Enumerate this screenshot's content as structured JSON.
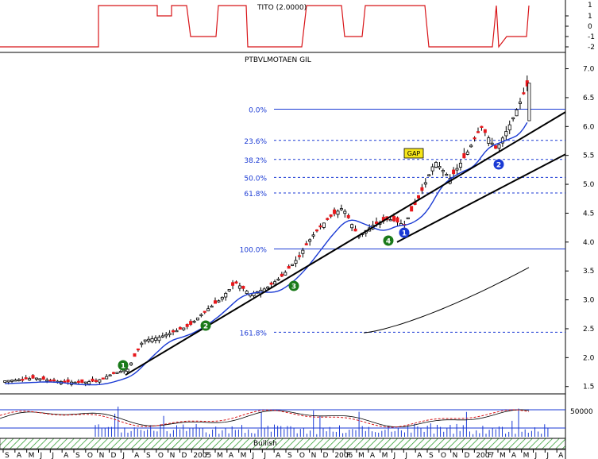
{
  "chart_data": {
    "type": "candlestick",
    "indicator_panel": {
      "label": "TITO (2.0000)",
      "y_ticks": [
        "1",
        "0",
        "-1",
        "-2"
      ],
      "y_top_tick": "1"
    },
    "price_panel": {
      "symbol": "PTBVLMOTAEN GIL",
      "y_ticks": [
        7.0,
        6.5,
        6.0,
        5.5,
        5.0,
        4.5,
        4.0,
        3.5,
        3.0,
        2.5,
        2.0,
        1.5
      ],
      "ylim": [
        1.4,
        7.2
      ],
      "fibonacci": [
        {
          "label": "0.0%",
          "value": 6.3,
          "style": "solid"
        },
        {
          "label": "23.6%",
          "value": 5.76,
          "style": "dashed"
        },
        {
          "label": "38.2%",
          "value": 5.43,
          "style": "dashed"
        },
        {
          "label": "50.0%",
          "value": 5.12,
          "style": "dashed"
        },
        {
          "label": "61.8%",
          "value": 4.85,
          "style": "dashed"
        },
        {
          "label": "100.0%",
          "value": 3.88,
          "style": "solid"
        },
        {
          "label": "161.8%",
          "value": 2.44,
          "style": "dashed"
        }
      ],
      "annotations": [
        {
          "label": "GAP"
        },
        {
          "label": "1",
          "color": "#1a7a1a"
        },
        {
          "label": "2",
          "color": "#1a7a1a"
        },
        {
          "label": "3",
          "color": "#1a7a1a"
        },
        {
          "label": "4",
          "color": "#1a7a1a"
        },
        {
          "label": "1",
          "color": "#1a3ad4"
        },
        {
          "label": "2",
          "color": "#1a3ad4"
        }
      ],
      "series": [
        {
          "kind": "price",
          "closes": [
            1.6,
            1.62,
            1.65,
            1.6,
            1.58,
            1.57,
            1.6,
            1.72,
            1.8,
            2.3,
            2.35,
            2.45,
            2.55,
            2.8,
            3.0,
            3.3,
            3.1,
            3.2,
            3.4,
            3.7,
            4.1,
            4.4,
            4.6,
            4.1,
            4.3,
            4.4,
            4.3,
            4.8,
            5.4,
            5.1,
            5.5,
            6.0,
            5.6,
            6.1,
            6.7
          ]
        },
        {
          "kind": "moving_average",
          "color": "#1a3ad4"
        },
        {
          "kind": "long_average",
          "color": "#000000"
        }
      ],
      "trendlines": [
        {
          "from": [
            "2004-12",
            1.7
          ],
          "to": [
            "2007-05",
            6.2
          ]
        },
        {
          "from": [
            "2006-08",
            4.35
          ],
          "to": [
            "2007-05",
            5.5
          ]
        }
      ]
    },
    "oscillator_panel": {
      "volume_tick": "50000",
      "band_label": "Bullish"
    },
    "x_axis": {
      "month_labels": [
        "J",
        "A",
        "S",
        "O",
        "N",
        "D",
        "2005",
        "F",
        "M",
        "A",
        "M",
        "J",
        "J",
        "A",
        "S",
        "O",
        "N",
        "D",
        "2006",
        "F",
        "M",
        "A",
        "M",
        "J",
        "J",
        "A",
        "S",
        "O",
        "N",
        "D",
        "2007",
        "F",
        "M",
        "A",
        "M",
        "J",
        "J",
        "A"
      ],
      "first_labels": [
        "S",
        "A",
        "M",
        "J",
        "J",
        "A",
        "S",
        "O",
        "N",
        "D"
      ]
    }
  }
}
